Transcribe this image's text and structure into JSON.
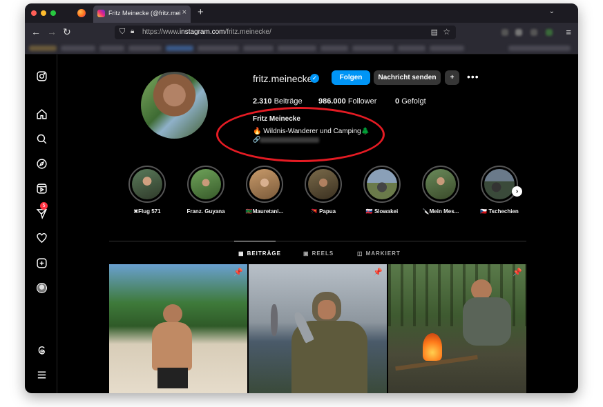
{
  "browser": {
    "tab_title": "Fritz Meinecke (@fritz.meinecke)",
    "tab_close": "×",
    "new_tab": "+",
    "tab_list": "⌄",
    "url_prefix": "https://www.",
    "url_domain": "instagram.com",
    "url_path": "/fritz.meinecke/",
    "menu": "≡"
  },
  "sidebar": {
    "notification_badge": "5"
  },
  "profile": {
    "username": "fritz.meinecke",
    "verified_mark": "✓",
    "follow_label": "Folgen",
    "message_label": "Nachricht senden",
    "add_user_label": "+",
    "more_label": "•••",
    "posts_count": "2.310",
    "posts_label": "Beiträge",
    "followers_count": "986.000",
    "followers_label": "Follower",
    "following_count": "0",
    "following_label": "Gefolgt",
    "full_name": "Fritz Meinecke",
    "bio": "🔥 Wildnis-Wanderer und Camping🌲",
    "link_icon": "🔗"
  },
  "highlights": [
    {
      "label": "✖Flug 571",
      "color1": "#5a7a5a",
      "color2": "#2f3a2a"
    },
    {
      "label": "Franz. Guyana",
      "color1": "#6fa35a",
      "color2": "#375a2a"
    },
    {
      "label": "🇲🇷Mauretani...",
      "color1": "#c89a6a",
      "color2": "#7a5a3a"
    },
    {
      "label": "🇵🇬 Papua",
      "color1": "#7a6a4a",
      "color2": "#3a3020"
    },
    {
      "label": "🇸🇰 Slowakei",
      "color1": "#8aa0b8",
      "color2": "#6a7a4a"
    },
    {
      "label": "🔪Mein Mes...",
      "color1": "#6a8a5a",
      "color2": "#3a4a2a"
    },
    {
      "label": "🇨🇿 Tschechien",
      "color1": "#6a7a8a",
      "color2": "#3a4a3a"
    }
  ],
  "highlights_next": "›",
  "post_tabs": {
    "posts_icon": "▦",
    "posts": "BEITRÄGE",
    "reels_icon": "▣",
    "reels": "REELS",
    "tagged_icon": "◫",
    "tagged": "MARKIERT"
  },
  "posts": [
    {
      "pin": "📌"
    },
    {
      "pin": "📌"
    },
    {
      "pin": "📌"
    }
  ]
}
